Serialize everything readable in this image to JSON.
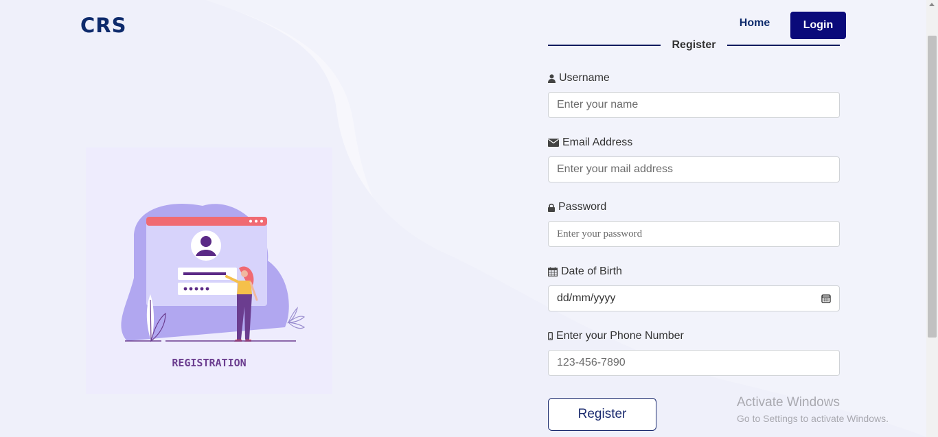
{
  "brand": "CRS",
  "nav": {
    "home": "Home",
    "login": "Login"
  },
  "illustration": {
    "caption": "REGISTRATION"
  },
  "form": {
    "title": "Register",
    "fields": [
      {
        "label": "Username",
        "icon": "user-icon",
        "placeholder": "Enter your name"
      },
      {
        "label": "Email Address",
        "icon": "envelope-icon",
        "placeholder": "Enter your mail address"
      },
      {
        "label": "Password",
        "icon": "lock-icon",
        "placeholder": "Enter your password"
      },
      {
        "label": "Date of Birth",
        "icon": "calendar-icon",
        "placeholder": "dd/mm/yyyy"
      },
      {
        "label": "Enter your Phone Number",
        "icon": "mobile-icon",
        "placeholder": "123-456-7890"
      }
    ],
    "submit": "Register"
  },
  "watermark": {
    "title": "Activate Windows",
    "subtitle": "Go to Settings to activate Windows."
  },
  "colors": {
    "brand": "#0d2a6b",
    "login_bg": "#0a0a7a",
    "illustration_accent": "#6b3d8f"
  }
}
